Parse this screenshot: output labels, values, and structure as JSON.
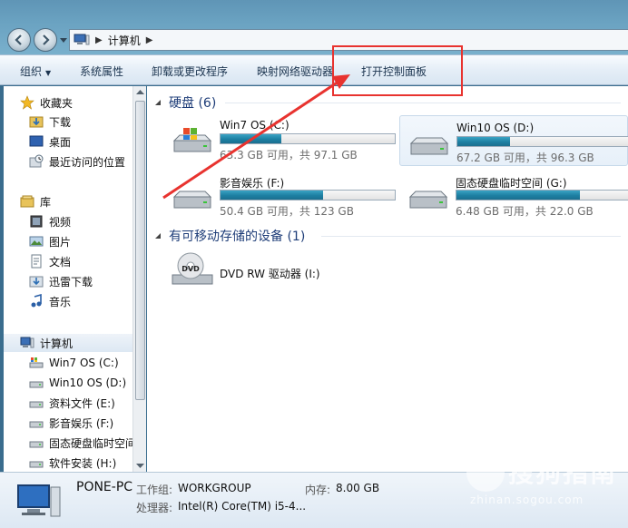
{
  "address": {
    "crumbs": [
      "计算机"
    ]
  },
  "commandbar": {
    "organize": "组织",
    "system_properties": "系统属性",
    "uninstall": "卸载或更改程序",
    "map_drive": "映射网络驱动器",
    "control_panel": "打开控制面板"
  },
  "nav": {
    "favorites": "收藏夹",
    "fav_items": [
      "下载",
      "桌面",
      "最近访问的位置"
    ],
    "libraries": "库",
    "lib_items": [
      "视频",
      "图片",
      "文档",
      "迅雷下载",
      "音乐"
    ],
    "computer": "计算机",
    "comp_items": [
      "Win7 OS (C:)",
      "Win10 OS (D:)",
      "资料文件 (E:)",
      "影音娱乐 (F:)",
      "固态硬盘临时空间",
      "软件安装 (H:)"
    ]
  },
  "main": {
    "hdd_section": "硬盘 (6)",
    "removable_section": "有可移动存储的设备 (1)",
    "drives": [
      {
        "name": "Win7 OS (C:)",
        "free": "63.3 GB 可用，共 97.1 GB",
        "used_fraction": 0.35
      },
      {
        "name": "Win10 OS (D:)",
        "free": "67.2 GB 可用，共 96.3 GB",
        "used_fraction": 0.3
      },
      {
        "name": "影音娱乐 (F:)",
        "free": "50.4 GB 可用，共 123 GB",
        "used_fraction": 0.59
      },
      {
        "name": "固态硬盘临时空间 (G:)",
        "free": "6.48 GB 可用，共 22.0 GB",
        "used_fraction": 0.71
      }
    ],
    "dvd": {
      "name": "DVD RW 驱动器 (I:)",
      "label": "DVD"
    }
  },
  "details": {
    "pc_name": "PONE-PC",
    "workgroup_label": "工作组:",
    "workgroup": "WORKGROUP",
    "memory_label": "内存:",
    "memory": "8.00 GB",
    "cpu_label": "处理器:",
    "cpu": "Intel(R) Core(TM) i5-4..."
  },
  "watermark": {
    "brand": "搜狗指南",
    "url": "zhinan.sogou.com"
  },
  "colors": {
    "annotation": "#e8332f",
    "bar_fill": "#1d7fa2",
    "section_text": "#1e3d78"
  }
}
